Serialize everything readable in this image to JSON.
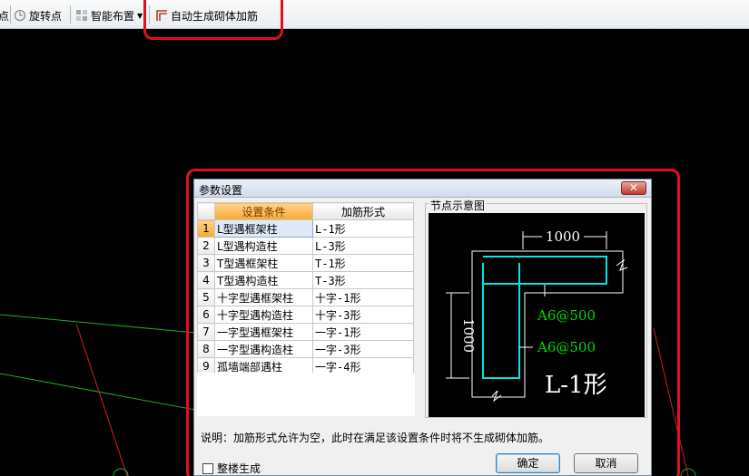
{
  "toolbar": {
    "items": [
      {
        "label": "点",
        "icon": "point-icon"
      },
      {
        "label": "旋转点",
        "icon": "rotate-point-icon"
      },
      {
        "label": "智能布置",
        "icon": "smart-layout-icon",
        "has_dropdown": true
      },
      {
        "label": "自动生成砌体加筋",
        "icon": "masonry-rebar-icon"
      }
    ]
  },
  "dialog": {
    "title": "参数设置",
    "close_glyph": "✕",
    "table": {
      "headers": [
        "设置条件",
        "加筋形式"
      ],
      "rows": [
        {
          "num": "1",
          "condition": "L型遇框架柱",
          "form": "L-1形"
        },
        {
          "num": "2",
          "condition": "L型遇构造柱",
          "form": "L-3形"
        },
        {
          "num": "3",
          "condition": "T型遇框架柱",
          "form": "T-1形"
        },
        {
          "num": "4",
          "condition": "T型遇构造柱",
          "form": "T-3形"
        },
        {
          "num": "5",
          "condition": "十字型遇框架柱",
          "form": "十字-1形"
        },
        {
          "num": "6",
          "condition": "十字型遇构造柱",
          "form": "十字-3形"
        },
        {
          "num": "7",
          "condition": "一字型遇框架柱",
          "form": "一字-1形"
        },
        {
          "num": "8",
          "condition": "一字型遇构造柱",
          "form": "一字-3形"
        },
        {
          "num": "9",
          "condition": "孤墙端部遇柱",
          "form": "一字-4形"
        }
      ]
    },
    "node_diagram": {
      "label": "节点示意图",
      "dim_top": "1000",
      "dim_left": "1000",
      "rebar_1": "A6@500",
      "rebar_2": "A6@500",
      "shape_label": "L-1形"
    },
    "note": "说明：加筋形式允许为空，此时在满足该设置条件时将不生成砌体加筋。",
    "whole_building_label": "整楼生成",
    "ok_label": "确定",
    "cancel_label": "取消"
  },
  "colors": {
    "canvas": "#000000",
    "highlight": "#e01020",
    "rebar": "#00e5e5",
    "dim": "#ffffff",
    "rebar_text": "#00dd00"
  }
}
